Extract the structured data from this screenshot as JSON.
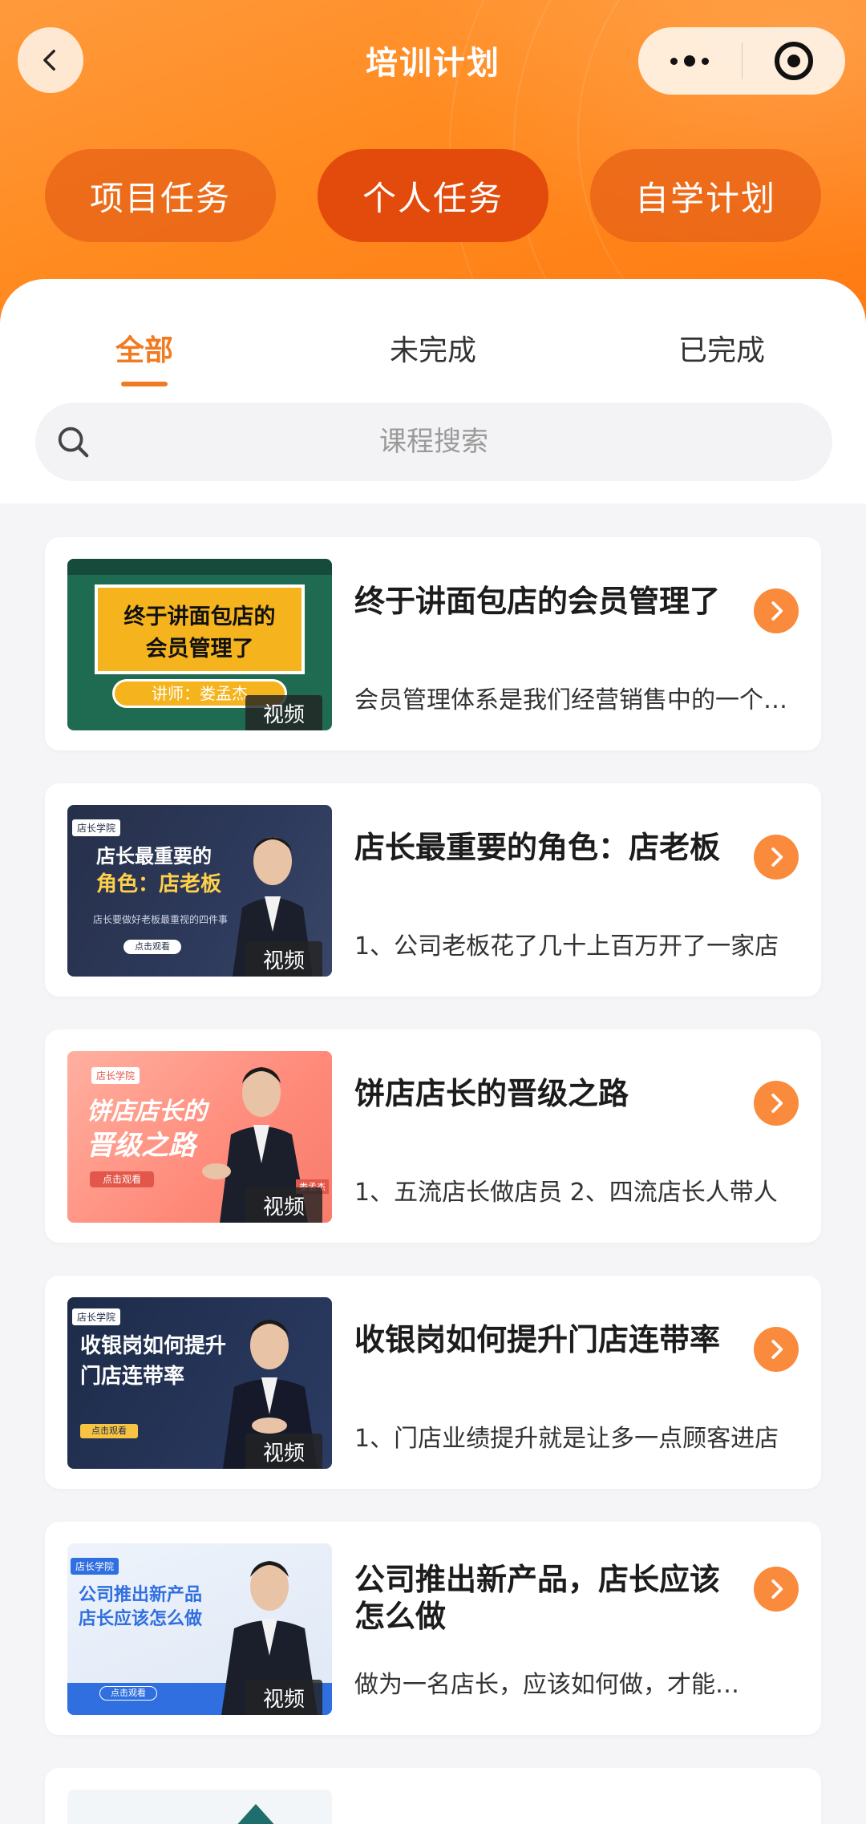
{
  "header": {
    "title": "培训计划",
    "tabs": [
      {
        "label": "项目任务",
        "active": false
      },
      {
        "label": "个人任务",
        "active": true
      },
      {
        "label": "自学计划",
        "active": false
      }
    ]
  },
  "filters": {
    "tabs": [
      {
        "label": "全部",
        "active": true
      },
      {
        "label": "未完成",
        "active": false
      },
      {
        "label": "已完成",
        "active": false
      }
    ]
  },
  "search": {
    "placeholder": "课程搜索"
  },
  "courses": [
    {
      "title": "终于讲面包店的会员管理了",
      "desc": "会员管理体系是我们经营销售中的一个重要环节",
      "badge": "视频",
      "thumb": {
        "line1": "终于讲面包店的",
        "line2": "会员管理了",
        "teacher": "讲师：娄孟杰"
      }
    },
    {
      "title": "店长最重要的角色：店老板",
      "desc": "1、公司老板花了几十上百万开了一家店",
      "badge": "视频",
      "thumb": {
        "tag": "店长学院",
        "line1": "店长最重要的",
        "line2": "角色：店老板",
        "sub": "店长要做好老板最重视的四件事",
        "btn": "点击观看"
      }
    },
    {
      "title": "饼店店长的晋级之路",
      "desc": "1、五流店长做店员 2、四流店长人带人",
      "badge": "视频",
      "thumb": {
        "tag": "店长学院",
        "line1": "饼店店长的",
        "line2": "晋级之路",
        "btn": "点击观看",
        "name": "娄孟杰"
      }
    },
    {
      "title": "收银岗如何提升门店连带率",
      "desc": "1、门店业绩提升就是让多一点顾客进店",
      "badge": "视频",
      "thumb": {
        "tag": "店长学院",
        "line1": "收银岗如何提升",
        "line2": "门店连带率",
        "btn": "点击观看"
      }
    },
    {
      "title": "公司推出新产品，店长应该怎么做",
      "desc": "做为一名店长，应该如何做，才能…",
      "badge": "视频",
      "thumb": {
        "tag": "店长学院",
        "line1": "公司推出新产品",
        "line2": "店长应该怎么做",
        "btn": "点击观看"
      }
    }
  ],
  "colors": {
    "header_orange": "#ff8a1f",
    "active_tab": "#e24b0c",
    "accent": "#f07b20",
    "arrow": "#fa8a3c"
  },
  "icons": [
    "back-chevron-icon",
    "more-dots-icon",
    "close-target-icon",
    "search-icon",
    "chevron-right-icon"
  ]
}
